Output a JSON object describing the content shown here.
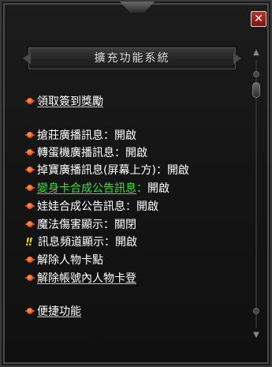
{
  "window": {
    "title": "擴充功能系統",
    "close_icon": "close-x-icon",
    "colors": {
      "accent_close": "#c0302a",
      "enabled_green": "#3fdf3f",
      "bullet": "#e04a10",
      "warning": "#e6d21e"
    }
  },
  "menu": {
    "daily_reward": {
      "label": "領取簽到獎勵"
    },
    "grab_broadcast": {
      "label": "搶莊廣播訊息",
      "sep": "：",
      "state": "開啟"
    },
    "gashapon_broadcast": {
      "label": "轉蛋機廣播訊息",
      "sep": "：",
      "state": "開啟"
    },
    "drop_broadcast": {
      "label": "掉寶廣播訊息(屏幕上方)",
      "sep": "：",
      "state": "開啟"
    },
    "transform_notice": {
      "label": "變身卡合成公告訊息",
      "sep": "：",
      "state": "開啟"
    },
    "doll_notice": {
      "label": "娃娃合成公告訊息",
      "sep": "：",
      "state": "開啟"
    },
    "magic_damage": {
      "label": "魔法傷害顯示",
      "sep": "：",
      "state": "關閉"
    },
    "channel_display": {
      "label": "訊息頻道顯示",
      "sep": "：",
      "state": "開啟"
    },
    "unstuck_character": {
      "label": "解除人物卡點"
    },
    "unstuck_account": {
      "label": "解除帳號內人物卡登"
    },
    "quick_functions": {
      "label": "便捷功能"
    }
  }
}
